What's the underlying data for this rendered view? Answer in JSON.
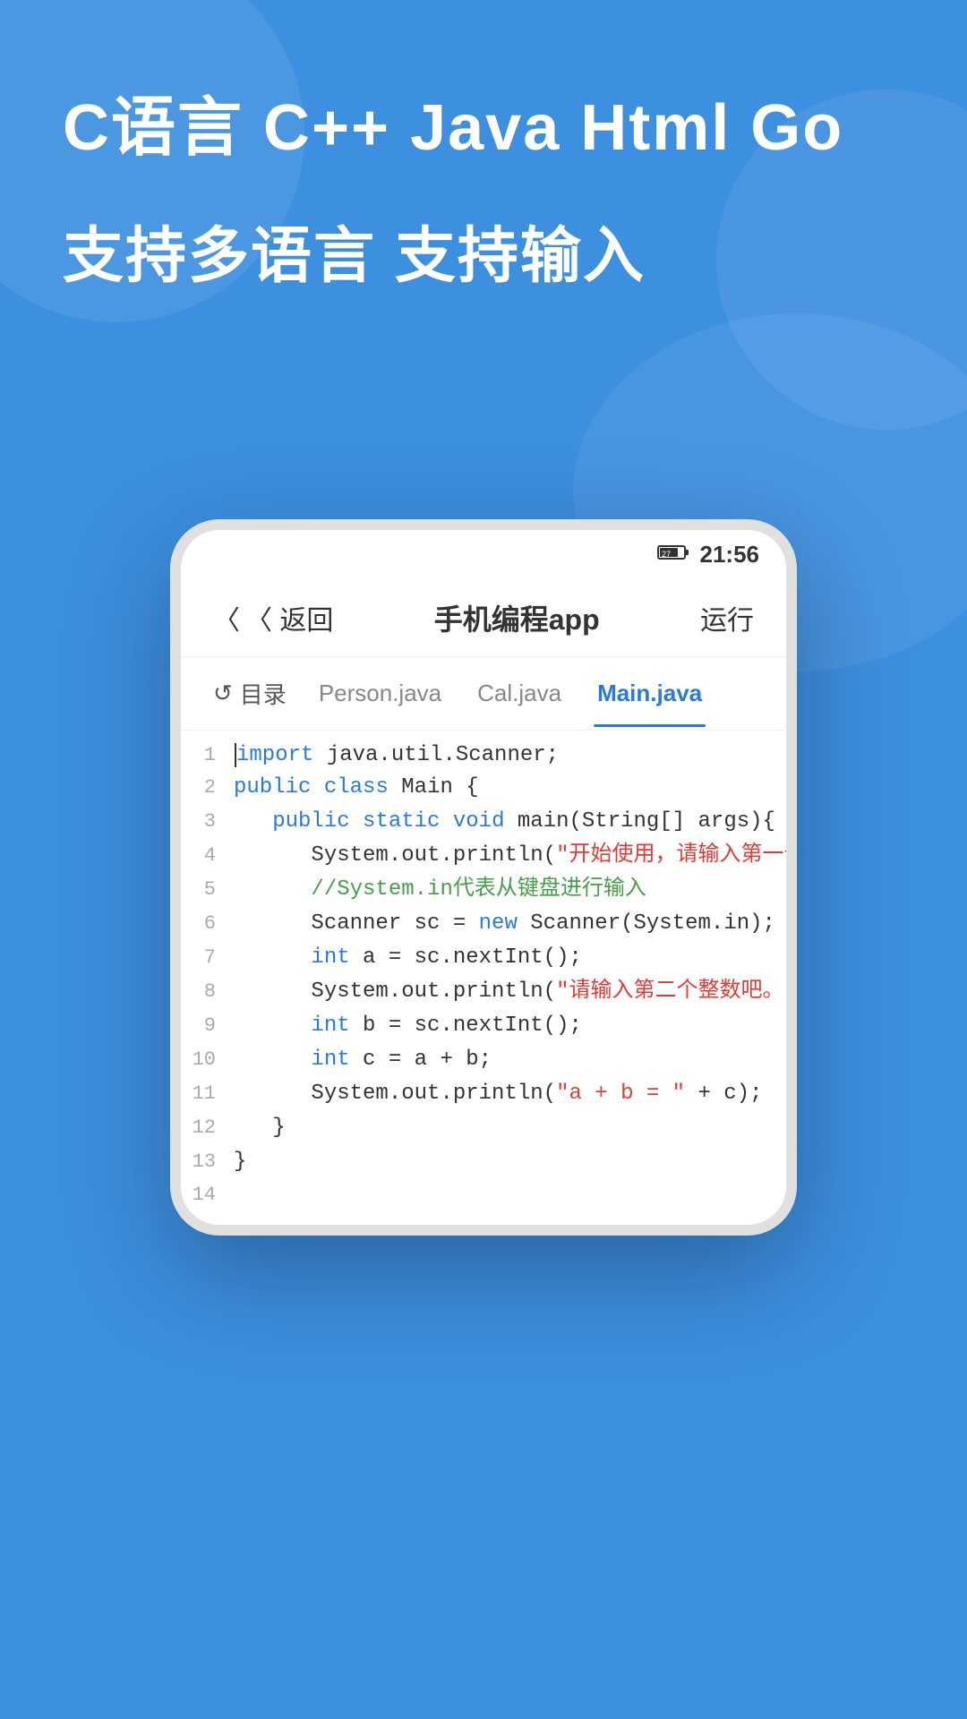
{
  "background": {
    "color": "#3d8fe0"
  },
  "hero": {
    "languages": "C语言  C++  Java  Html  Go",
    "subtitle": "支持多语言 支持输入"
  },
  "phone": {
    "status_bar": {
      "battery": "27",
      "time": "21:56"
    },
    "header": {
      "back_label": "〈 返回",
      "title": "手机编程app",
      "run_label": "运行"
    },
    "tabs": [
      {
        "id": "folder",
        "label": "目录",
        "icon": "↺",
        "active": false
      },
      {
        "id": "person",
        "label": "Person.java",
        "active": false
      },
      {
        "id": "cal",
        "label": "Cal.java",
        "active": false
      },
      {
        "id": "main",
        "label": "Main.java",
        "active": true
      }
    ],
    "code_lines": [
      {
        "num": "1",
        "content": "import java.util.Scanner;"
      },
      {
        "num": "2",
        "content": "public class Main {"
      },
      {
        "num": "3",
        "content": "   public static void main(String[] args){"
      },
      {
        "num": "4",
        "content": "      System.out.println(\"开始使用，请输入第一个整数吧。\");"
      },
      {
        "num": "5",
        "content": "      //System.in代表从键盘进行输入"
      },
      {
        "num": "6",
        "content": "      Scanner sc = new Scanner(System.in);"
      },
      {
        "num": "7",
        "content": "      int a = sc.nextInt();"
      },
      {
        "num": "8",
        "content": "      System.out.println(\"请输入第二个整数吧。\");"
      },
      {
        "num": "9",
        "content": "      int b = sc.nextInt();"
      },
      {
        "num": "10",
        "content": "      int c = a + b;"
      },
      {
        "num": "11",
        "content": "      System.out.println(\"a + b = \" + c);"
      },
      {
        "num": "12",
        "content": "   }"
      },
      {
        "num": "13",
        "content": "}"
      },
      {
        "num": "14",
        "content": ""
      }
    ]
  }
}
